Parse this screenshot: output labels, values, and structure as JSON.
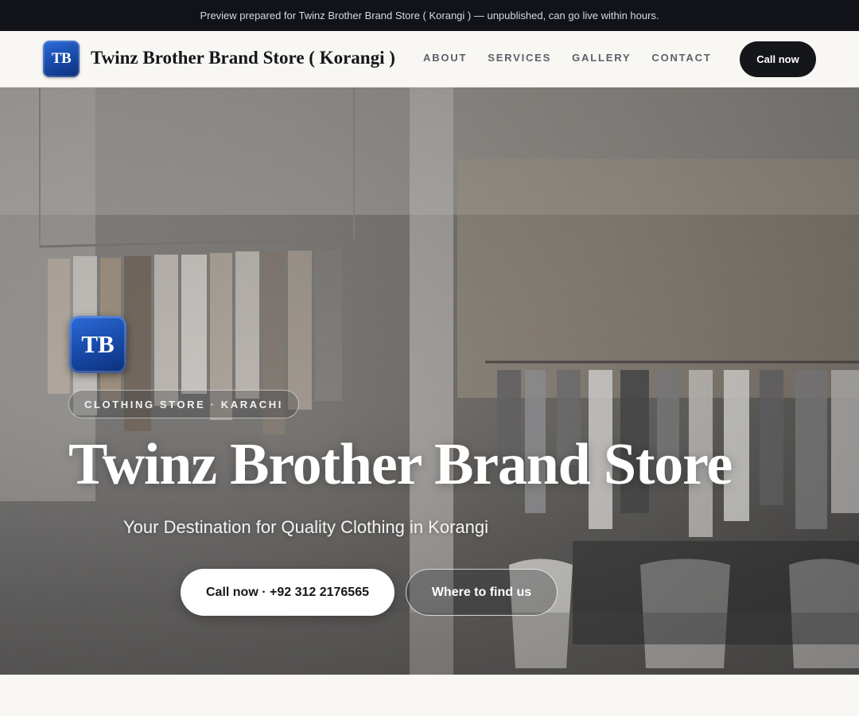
{
  "preview_banner": {
    "text": "Preview prepared for Twinz Brother Brand Store ( Korangi ) — unpublished, can go live within hours."
  },
  "header": {
    "logo_text": "TB",
    "brand_name": "Twinz Brother Brand Store ( Korangi )",
    "nav": [
      {
        "label": "ABOUT"
      },
      {
        "label": "SERVICES"
      },
      {
        "label": "GALLERY"
      },
      {
        "label": "CONTACT"
      }
    ],
    "cta_label": "Call now"
  },
  "hero": {
    "logo_text": "TB",
    "eyebrow": "CLOTHING STORE · KARACHI",
    "title": "Twinz Brother Brand Store",
    "subtitle": "Your Destination for Quality Clothing in Korangi",
    "primary_button": "Call now · +92 312 2176565",
    "secondary_button": "Where to find us",
    "background_image": "clothing-store-interior-photo"
  },
  "colors": {
    "banner_bg": "#111318",
    "header_bg": "#f8f7f4",
    "dark": "#14161a",
    "logo_blue": "#1a4fb0"
  }
}
